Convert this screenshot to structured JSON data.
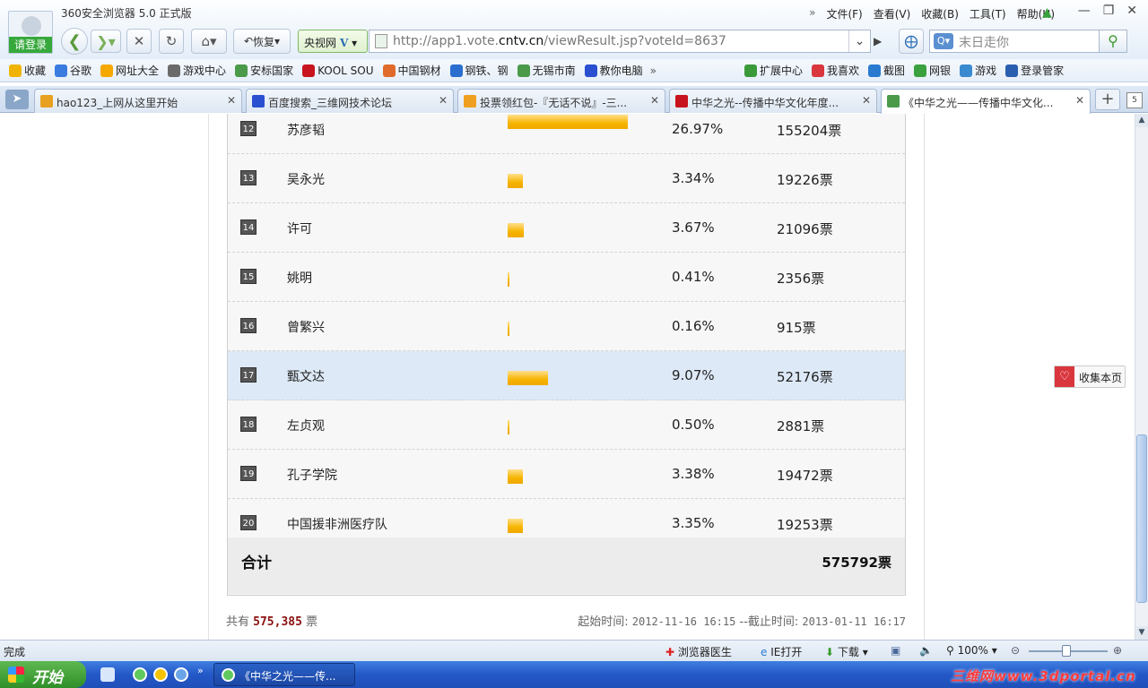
{
  "window": {
    "app_title": "360安全浏览器 5.0 正式版",
    "login_label": "请登录",
    "menu": [
      "文件(F)",
      "查看(V)",
      "收藏(B)",
      "工具(T)",
      "帮助(H)"
    ],
    "menu_chevron": "»"
  },
  "toolbar": {
    "restore_label": "恢复",
    "cctv_label": "央视网",
    "cctv_logo": "V",
    "url_prefix": "http://app1.vote.",
    "url_domain": "cntv.cn",
    "url_suffix": "/viewResult.jsp?voteId=8637",
    "search_placeholder": "末日走你"
  },
  "bookmarks": {
    "left": [
      {
        "label": "收藏",
        "icon": "star-icon",
        "color": "#f0b400"
      },
      {
        "label": "谷歌",
        "icon": "google-icon",
        "color": "#3a7be0"
      },
      {
        "label": "网址大全",
        "icon": "sites-icon",
        "color": "#f5a800"
      },
      {
        "label": "游戏中心",
        "icon": "gamepad-icon",
        "color": "#6a6a6a"
      },
      {
        "label": "安标国家",
        "icon": "page-icon",
        "color": "#4a9a4a"
      },
      {
        "label": "KOOL SOU",
        "icon": "kool-icon",
        "color": "#c8141e"
      },
      {
        "label": "中国钢材",
        "icon": "steel-icon",
        "color": "#e06a2a"
      },
      {
        "label": "钢铁、钢",
        "icon": "globe-icon",
        "color": "#2a6fd0"
      },
      {
        "label": "无锡市南",
        "icon": "page-icon",
        "color": "#4a9a4a"
      },
      {
        "label": "教你电脑",
        "icon": "paw-icon",
        "color": "#2a4fd0"
      }
    ],
    "more": "»",
    "right": [
      {
        "label": "扩展中心",
        "icon": "box-icon",
        "color": "#3a9a3a"
      },
      {
        "label": "我喜欢",
        "icon": "heart-icon",
        "color": "#d9363e"
      },
      {
        "label": "截图",
        "icon": "screenshot-icon",
        "color": "#2a7bd0"
      },
      {
        "label": "网银",
        "icon": "bank-icon",
        "color": "#3aa13e"
      },
      {
        "label": "游戏",
        "icon": "game-icon",
        "color": "#3a8ad0"
      },
      {
        "label": "登录管家",
        "icon": "key-icon",
        "color": "#2a5fb0"
      }
    ]
  },
  "tabs": [
    {
      "label": "hao123_上网从这里开始",
      "icon_color": "#e8a020"
    },
    {
      "label": "百度搜索_三维网技术论坛",
      "icon_color": "#2a4fd0"
    },
    {
      "label": "投票领红包-『无话不说』-三...",
      "icon_color": "#f0a020"
    },
    {
      "label": "中华之光--传播中华文化年度...",
      "icon_color": "#c8141e"
    },
    {
      "label": "《中华之光——传播中华文化...",
      "icon_color": "#4a9a4a"
    }
  ],
  "tab_count": "5",
  "vote_rows": [
    {
      "rank": "12",
      "name": "苏彦韬",
      "pct": "26.97%",
      "votes": "155204票",
      "pct_value": 26.97
    },
    {
      "rank": "13",
      "name": "吴永光",
      "pct": "3.34%",
      "votes": "19226票",
      "pct_value": 3.34
    },
    {
      "rank": "14",
      "name": "许可",
      "pct": "3.67%",
      "votes": "21096票",
      "pct_value": 3.67
    },
    {
      "rank": "15",
      "name": "姚明",
      "pct": "0.41%",
      "votes": "2356票",
      "pct_value": 0.41
    },
    {
      "rank": "16",
      "name": "曾繁兴",
      "pct": "0.16%",
      "votes": "915票",
      "pct_value": 0.16
    },
    {
      "rank": "17",
      "name": "甄文达",
      "pct": "9.07%",
      "votes": "52176票",
      "pct_value": 9.07
    },
    {
      "rank": "18",
      "name": "左贞观",
      "pct": "0.50%",
      "votes": "2881票",
      "pct_value": 0.5
    },
    {
      "rank": "19",
      "name": "孔子学院",
      "pct": "3.38%",
      "votes": "19472票",
      "pct_value": 3.38
    },
    {
      "rank": "20",
      "name": "中国援非洲医疗队",
      "pct": "3.35%",
      "votes": "19253票",
      "pct_value": 3.35
    }
  ],
  "highlight_rank": "17",
  "total": {
    "label": "合计",
    "value": "575792票"
  },
  "footer": {
    "prefix": "共有",
    "count": "575,385",
    "unit": "票",
    "start_label": "起始时间:",
    "start": "2012-11-16 16:15",
    "sep": "--截止时间:",
    "end": "2013-01-11 16:17"
  },
  "fav_button": "收集本页",
  "status": {
    "done": "完成",
    "doctor": "浏览器医生",
    "ie_open": "IE打开",
    "download": "下载",
    "zoom": "100%"
  },
  "taskbar": {
    "start": "开始",
    "window_item": "《中华之光——传...",
    "brand": "三维网www.3dportal.cn"
  }
}
